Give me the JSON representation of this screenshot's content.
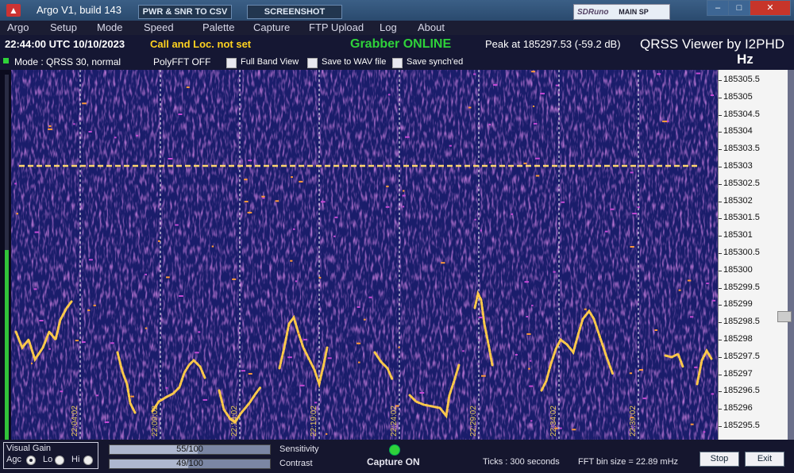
{
  "title": "Argo V1, build 143",
  "toolbar": {
    "pwr_label": "PWR & SNR TO CSV",
    "screenshot_label": "SCREENSHOT",
    "sdr_logo": "SDRuno",
    "sdr_label": "MAIN SP"
  },
  "window": {
    "min": "–",
    "max": "□",
    "close": "✕"
  },
  "menu": [
    "Argo",
    "Setup",
    "Mode",
    "Speed",
    "Palette",
    "Capture",
    "FTP Upload",
    "Log",
    "About"
  ],
  "status": {
    "datetime": "22:44:00 UTC  10/10/2023",
    "call": "Call and Loc. not set",
    "grabber": "Grabber ONLINE",
    "peak": "Peak at  185297.53 (-59.2 dB)",
    "viewer": "QRSS Viewer by I2PHD",
    "hz": "Hz",
    "mode": "Mode : QRSS 30, normal",
    "polyfft": "PolyFFT OFF",
    "full_band": "Full Band View",
    "save_wav": "Save to WAV file",
    "save_sync": "Save synch'ed"
  },
  "freq_labels": [
    "185305.5",
    "185305",
    "185304.5",
    "185304",
    "185303.5",
    "185303",
    "185302.5",
    "185302",
    "185301.5",
    "185301",
    "185300.5",
    "185300",
    "185299.5",
    "185299",
    "185298.5",
    "185298",
    "185297.5",
    "185297",
    "185296.5",
    "185296",
    "185295.5"
  ],
  "time_labels": [
    "22:04:02",
    "22:09:02",
    "22:14:02",
    "22:19:02",
    "22:24:02",
    "22:29:02",
    "22:34:02",
    "22:39:02"
  ],
  "bottom": {
    "visual_gain": "Visual Gain",
    "agc": "Agc",
    "lo": "Lo",
    "hi": "Hi",
    "sensitivity_value": "55/100",
    "sensitivity_label": "Sensitivity",
    "contrast_value": "49/100",
    "contrast_label": "Contrast",
    "capture": "Capture ON",
    "ticks": "Ticks   : 300 seconds",
    "fft": "FFT bin size = 22.89 mHz",
    "stop": "Stop",
    "exit": "Exit"
  },
  "levels": {
    "sensitivity": 0.55,
    "contrast": 0.49
  },
  "colors": {
    "grabber": "#2fd23a",
    "call": "#ffd21f",
    "signal": "#ffc94a",
    "waterfall_bg": "#1a1d6b"
  }
}
